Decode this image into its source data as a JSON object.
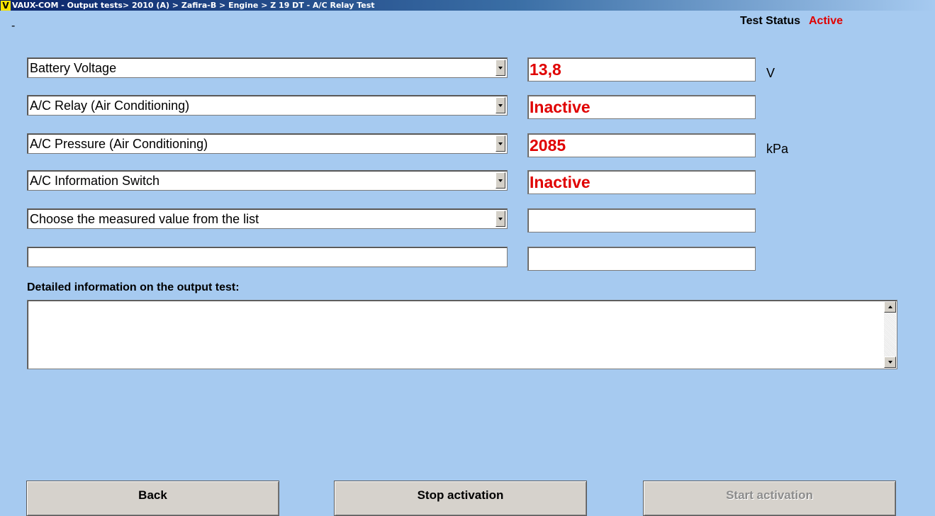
{
  "window": {
    "logo": "V",
    "title": "VAUX-COM - Output tests> 2010 (A) > Zafira-B > Engine > Z 19 DT - A/C Relay Test"
  },
  "header": {
    "dash": "-",
    "test_status_label": "Test Status",
    "test_status_value": "Active",
    "status_color": "#e00000"
  },
  "measurements": [
    {
      "name": "Battery Voltage",
      "value": "13,8",
      "unit": "V"
    },
    {
      "name": "A/C Relay (Air Conditioning)",
      "value": "Inactive",
      "unit": ""
    },
    {
      "name": "A/C Pressure (Air Conditioning)",
      "value": "2085",
      "unit": "kPa"
    },
    {
      "name": "A/C Information Switch",
      "value": "Inactive",
      "unit": ""
    },
    {
      "name": "Choose the measured value from the list",
      "value": "",
      "unit": ""
    }
  ],
  "extra_row": {
    "field": "",
    "value": ""
  },
  "details": {
    "label": "Detailed information on the output test:",
    "text": ""
  },
  "buttons": {
    "back": "Back",
    "stop": "Stop activation",
    "start": "Start activation"
  }
}
